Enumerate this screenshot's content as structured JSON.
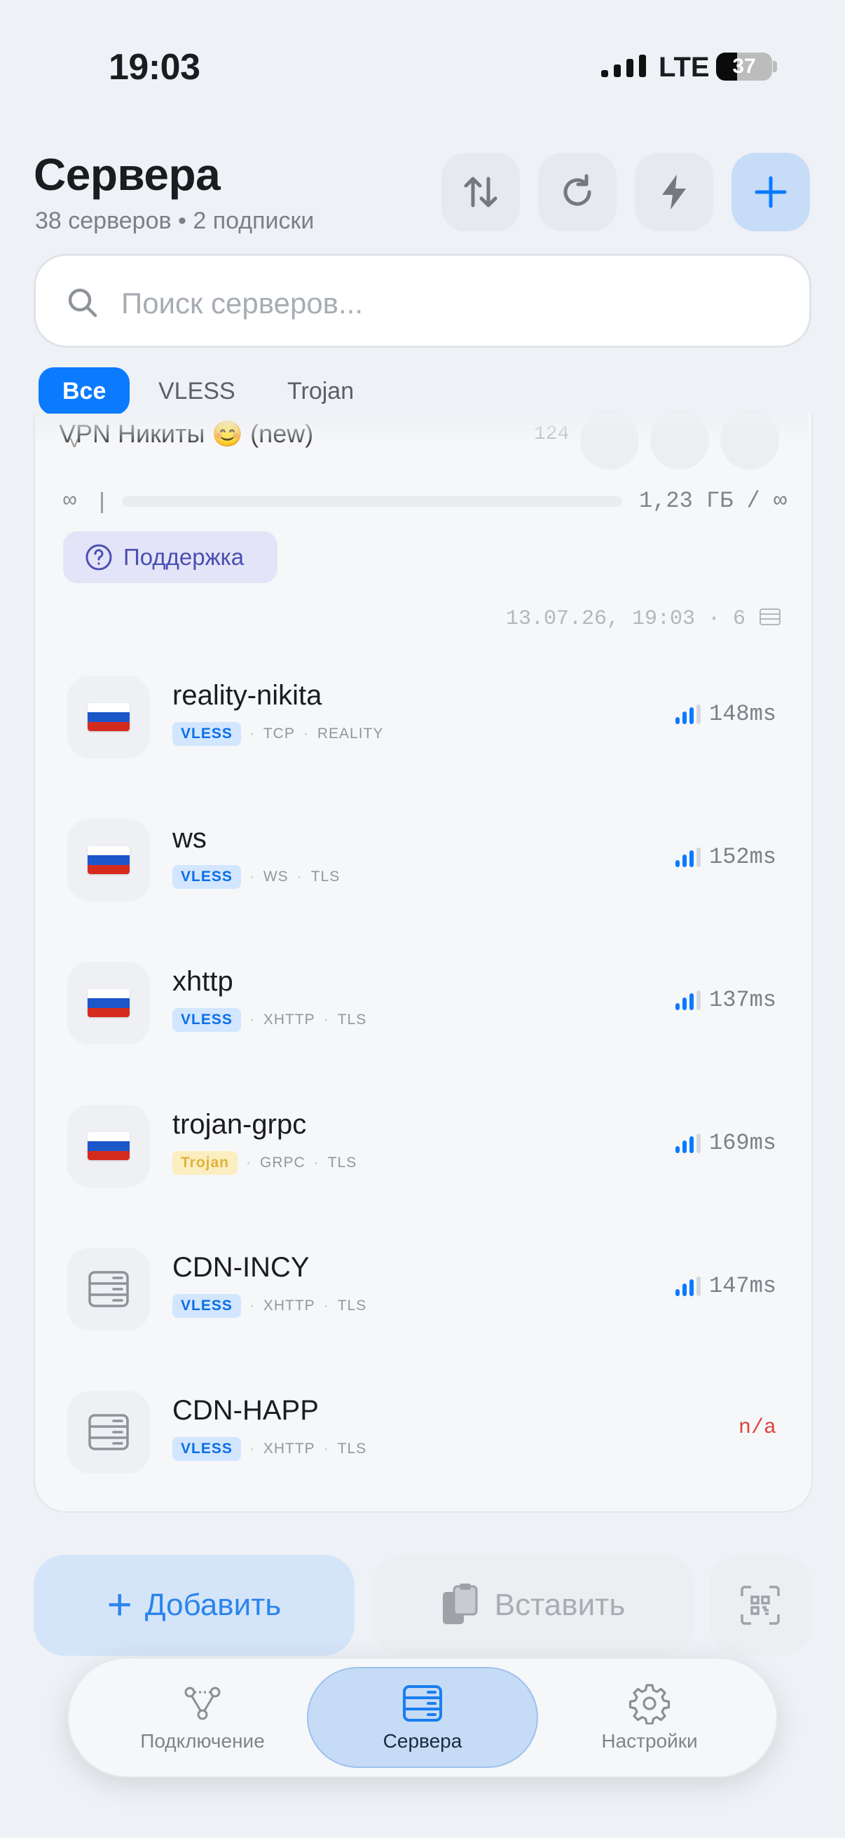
{
  "status_bar": {
    "time": "19:03",
    "network": "LTE",
    "battery": "37",
    "battery_level": 0.37
  },
  "header": {
    "title": "Сервера",
    "subtitle": "38 серверов • 2 подписки",
    "buttons": {
      "sort": "sort-icon",
      "refresh": "refresh-icon",
      "test": "lightning-icon",
      "add": "plus-icon"
    }
  },
  "search": {
    "placeholder": "Поиск серверов...",
    "value": ""
  },
  "filters": [
    {
      "label": "Все",
      "active": true
    },
    {
      "label": "VLESS",
      "active": false
    },
    {
      "label": "Trojan",
      "active": false
    }
  ],
  "subscription": {
    "name": "VPN Никиты 😊 (new)",
    "count": "124",
    "limit": "∞",
    "traffic": "1,23 ГБ / ∞",
    "support_label": "Поддержка",
    "updated": "13.07.26, 19:03 · 6"
  },
  "servers": [
    {
      "name": "reality-nikita",
      "icon": "flag-ru",
      "protocol": "VLESS",
      "transport": "TCP",
      "security": "REALITY",
      "ping": "148ms",
      "signal": 3
    },
    {
      "name": "ws",
      "icon": "flag-ru",
      "protocol": "VLESS",
      "transport": "WS",
      "security": "TLS",
      "ping": "152ms",
      "signal": 3
    },
    {
      "name": "xhttp",
      "icon": "flag-ru",
      "protocol": "VLESS",
      "transport": "XHTTP",
      "security": "TLS",
      "ping": "137ms",
      "signal": 3
    },
    {
      "name": "trojan-grpc",
      "icon": "flag-ru",
      "protocol": "Trojan",
      "transport": "GRPC",
      "security": "TLS",
      "ping": "169ms",
      "signal": 3
    },
    {
      "name": "CDN-INCY",
      "icon": "server-icon",
      "protocol": "VLESS",
      "transport": "XHTTP",
      "security": "TLS",
      "ping": "147ms",
      "signal": 3
    },
    {
      "name": "CDN-HAPP",
      "icon": "server-icon",
      "protocol": "VLESS",
      "transport": "XHTTP",
      "security": "TLS",
      "ping": "n/a",
      "signal": 0
    }
  ],
  "actions": {
    "add": "Добавить",
    "paste": "Вставить",
    "scan": "qr-scan-icon"
  },
  "tabs": [
    {
      "label": "Подключение",
      "icon": "connection-icon",
      "active": false
    },
    {
      "label": "Сервера",
      "icon": "servers-icon",
      "active": true
    },
    {
      "label": "Настройки",
      "icon": "gear-icon",
      "active": false
    }
  ],
  "colors": {
    "accent": "#0a7aff",
    "vless": "#0a6fe6",
    "trojan": "#e0b23a",
    "error": "#e0443e",
    "flag": [
      "#ffffff",
      "#1c57c9",
      "#d52b1e"
    ]
  }
}
